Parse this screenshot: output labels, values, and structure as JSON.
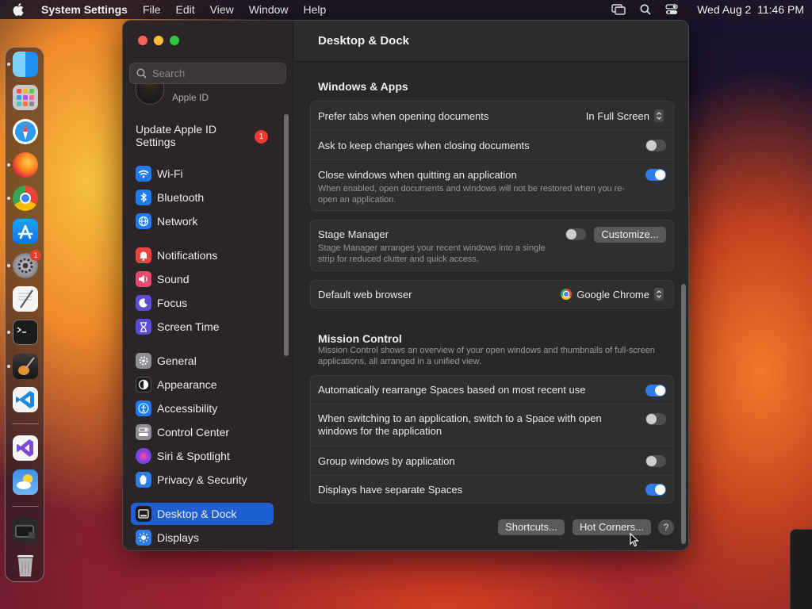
{
  "menubar": {
    "app_name": "System Settings",
    "items": [
      "File",
      "Edit",
      "View",
      "Window",
      "Help"
    ],
    "datetime": "Wed Aug 2  11:46 PM",
    "icons": [
      "apple-logo-icon",
      "screen-mirroring-icon",
      "spotlight-search-icon",
      "control-center-icon"
    ]
  },
  "dock": {
    "apps": [
      "finder",
      "launchpad",
      "safari",
      "firefox",
      "chrome",
      "app-store",
      "system-settings",
      "textedit",
      "terminal",
      "garageband",
      "vscode",
      "visual-studio",
      "weather",
      "screenshot",
      "trash"
    ],
    "settings_badge": "1"
  },
  "sidebar": {
    "search_placeholder": "Search",
    "apple_id_label": "Apple ID",
    "update_label": "Update Apple ID Settings",
    "update_badge": "1",
    "items": [
      {
        "label": "Wi-Fi",
        "icon": "wifi-icon",
        "color": "#1e7cf0"
      },
      {
        "label": "Bluetooth",
        "icon": "bluetooth-icon",
        "color": "#1e7cf0"
      },
      {
        "label": "Network",
        "icon": "globe-icon",
        "color": "#1e7cf0"
      },
      {
        "label": "Notifications",
        "icon": "bell-icon",
        "color": "#e9433f"
      },
      {
        "label": "Sound",
        "icon": "speaker-icon",
        "color": "#e94b6a"
      },
      {
        "label": "Focus",
        "icon": "moon-icon",
        "color": "#5b4ed6"
      },
      {
        "label": "Screen Time",
        "icon": "hourglass-icon",
        "color": "#5b4ed6"
      },
      {
        "label": "General",
        "icon": "gear-icon",
        "color": "#8e8e93"
      },
      {
        "label": "Appearance",
        "icon": "appearance-icon",
        "color": "#1c1c1e"
      },
      {
        "label": "Accessibility",
        "icon": "accessibility-icon",
        "color": "#1e7cf0"
      },
      {
        "label": "Control Center",
        "icon": "control-center-icon",
        "color": "#8e8e93"
      },
      {
        "label": "Siri & Spotlight",
        "icon": "siri-icon",
        "color": "#b04ad8"
      },
      {
        "label": "Privacy & Security",
        "icon": "hand-icon",
        "color": "#2f7ce6"
      },
      {
        "label": "Desktop & Dock",
        "icon": "dock-icon",
        "color": "#1c1c1e"
      },
      {
        "label": "Displays",
        "icon": "sun-icon",
        "color": "#2f7ce6"
      }
    ],
    "selected": "Desktop & Dock"
  },
  "content": {
    "title": "Desktop & Dock",
    "windows_apps": {
      "title": "Windows & Apps",
      "prefer_tabs_label": "Prefer tabs when opening documents",
      "prefer_tabs_value": "In Full Screen",
      "ask_keep_label": "Ask to keep changes when closing documents",
      "ask_keep_on": false,
      "close_windows_label": "Close windows when quitting an application",
      "close_windows_sub": "When enabled, open documents and windows will not be restored when you re-open an application.",
      "close_windows_on": true
    },
    "stage_manager": {
      "label": "Stage Manager",
      "sub": "Stage Manager arranges your recent windows into a single strip for reduced clutter and quick access.",
      "on": false,
      "customize_label": "Customize..."
    },
    "browser": {
      "label": "Default web browser",
      "value": "Google Chrome"
    },
    "mission_control": {
      "title": "Mission Control",
      "desc": "Mission Control shows an overview of your open windows and thumbnails of full-screen applications, all arranged in a unified view.",
      "rows": [
        {
          "label": "Automatically rearrange Spaces based on most recent use",
          "on": true
        },
        {
          "label": "When switching to an application, switch to a Space with open windows for the application",
          "on": false
        },
        {
          "label": "Group windows by application",
          "on": false
        },
        {
          "label": "Displays have separate Spaces",
          "on": true
        }
      ]
    },
    "shortcuts_label": "Shortcuts...",
    "hot_corners_label": "Hot Corners...",
    "help_label": "?"
  }
}
